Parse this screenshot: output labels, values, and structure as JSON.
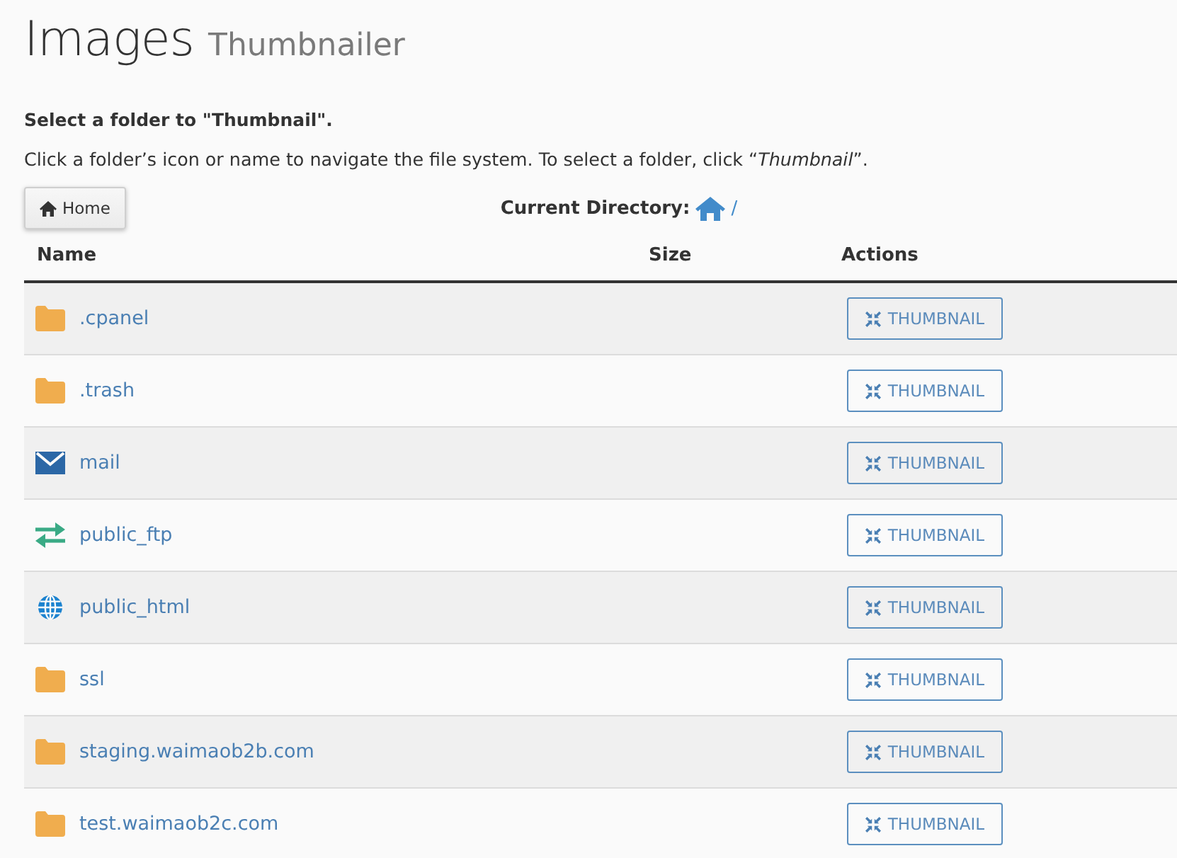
{
  "page_header": {
    "title": "Images",
    "subtitle": "Thumbnailer"
  },
  "instructions": {
    "heading": "Select a folder to \"Thumbnail\".",
    "description": "Click a folder’s icon or name to navigate the file system. To select a folder, click “*Thumbnail*”."
  },
  "toolbar": {
    "home_button": "Home",
    "current_directory_label": "Current Directory:",
    "current_path": "/"
  },
  "table": {
    "columns": [
      "Name",
      "Size",
      "Actions"
    ],
    "rows": [
      {
        "kind": "folder",
        "name": ".cpanel",
        "action": "THUMBNAIL"
      },
      {
        "kind": "folder",
        "name": ".trash",
        "action": "THUMBNAIL"
      },
      {
        "kind": "mail",
        "name": "mail",
        "action": "THUMBNAIL"
      },
      {
        "kind": "transfer",
        "name": "public_ftp",
        "action": "THUMBNAIL"
      },
      {
        "kind": "web",
        "name": "public_html",
        "action": "THUMBNAIL"
      },
      {
        "kind": "folder",
        "name": "ssl",
        "action": "THUMBNAIL"
      },
      {
        "kind": "folder",
        "name": "staging.waimaob2b.com",
        "action": "THUMBNAIL"
      },
      {
        "kind": "folder",
        "name": "test.waimaob2c.com",
        "action": "THUMBNAIL"
      }
    ]
  }
}
